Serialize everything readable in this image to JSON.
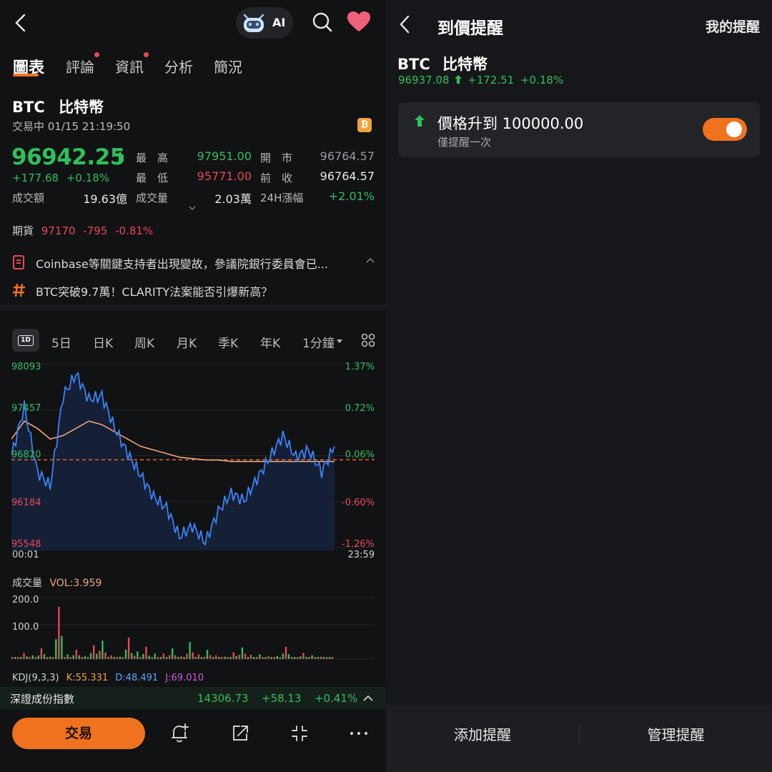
{
  "left": {
    "header": {
      "ai_label": "AI"
    },
    "tabs": [
      {
        "label": "圖表",
        "active": true
      },
      {
        "label": "評論",
        "dot": true
      },
      {
        "label": "資訊",
        "dot": true
      },
      {
        "label": "分析"
      },
      {
        "label": "簡況"
      }
    ],
    "asset": {
      "symbol": "BTC",
      "name": "比特幣",
      "status": "交易中 01/15 21:19:50",
      "price": "96942.25",
      "change": "+177.68",
      "change_pct": "+0.18%",
      "stats": [
        {
          "label": "最　高",
          "value": "97951.00",
          "color": "green"
        },
        {
          "label": "最　低",
          "value": "95771.00",
          "color": "red"
        },
        {
          "label": "開　市",
          "value": "96764.57",
          "color": "grey"
        },
        {
          "label": "前　收",
          "value": "96764.57",
          "color": "white"
        },
        {
          "label": "成交額",
          "value": "19.63億",
          "color": "white"
        },
        {
          "label": "成交量",
          "value": "2.03萬",
          "color": "white"
        },
        {
          "label": "24H漲幅",
          "value": "+2.01%",
          "color": "green"
        }
      ],
      "futures": {
        "label": "期貨",
        "price": "97170",
        "change": "-795",
        "pct": "-0.81%"
      }
    },
    "news": [
      {
        "text": "Coinbase等關鍵支持者出現變故，參議院銀行委員會已...",
        "icon": "news-icon"
      },
      {
        "text": "BTC突破9.7萬！CLARITY法案能否引爆新高？",
        "icon": "hashtag-icon"
      }
    ],
    "periods": [
      "1D",
      "5日",
      "日K",
      "周K",
      "月K",
      "季K",
      "年K",
      "1分鐘"
    ],
    "chart": {
      "y_left": [
        "98093",
        "97457",
        "96820",
        "96184",
        "95548"
      ],
      "y_right": [
        "1.37%",
        "0.72%",
        "0.06%",
        "-0.60%",
        "-1.26%"
      ],
      "x_start": "00:01",
      "x_end": "23:59"
    },
    "volume": {
      "label": "成交量",
      "vol": "VOL:3.959",
      "ticks": [
        "200.0",
        "100.0"
      ]
    },
    "kdj": {
      "label": "KDJ(9,3,3)",
      "k": "K:55.331",
      "d": "D:48.491",
      "j": "J:69.010"
    },
    "index_bar": {
      "name": "深證成份指數",
      "value": "14306.73",
      "change": "+58.13",
      "pct": "+0.41%"
    },
    "trade_button": "交易"
  },
  "right": {
    "title": "到價提醒",
    "my_alerts": "我的提醒",
    "asset": {
      "symbol": "BTC",
      "name": "比特幣",
      "price": "96937.08",
      "change": "+172.51",
      "pct": "+0.18%"
    },
    "alert": {
      "text": "價格升到 100000.00",
      "sub": "僅提醒一次",
      "enabled": true
    },
    "add_button": "添加提醒",
    "manage_button": "管理提醒"
  },
  "chart_data": {
    "type": "line",
    "title": "",
    "x_range": [
      "00:01",
      "23:59"
    ],
    "ylim": [
      95548,
      98093
    ],
    "prev_close": 96764.57,
    "series": [
      {
        "values": [
          96820,
          97500,
          96600,
          96400,
          97650,
          97950,
          97600,
          97650,
          97200,
          96850,
          96550,
          96250,
          96100,
          95700,
          95850,
          95620,
          96050,
          96300,
          96200,
          96500,
          96800,
          97100,
          96800,
          96900,
          96600,
          96950
        ]
      },
      {
        "values": [
          97050,
          97300,
          97200,
          97050,
          97100,
          97200,
          97300,
          97250,
          97150,
          97050,
          96950,
          96900,
          96850,
          96800,
          96780,
          96760,
          96760,
          96740,
          96740,
          96740,
          96740,
          96740,
          96740,
          96740,
          96740,
          96740
        ]
      }
    ],
    "volume": [
      6,
      20,
      12,
      35,
      8,
      170,
      15,
      30,
      10,
      45,
      60,
      12,
      8,
      70,
      25,
      40,
      18,
      18,
      35,
      9,
      55,
      15,
      30,
      12,
      8,
      22,
      38,
      14,
      15,
      9,
      10,
      40,
      6,
      20,
      12,
      8,
      5
    ]
  }
}
